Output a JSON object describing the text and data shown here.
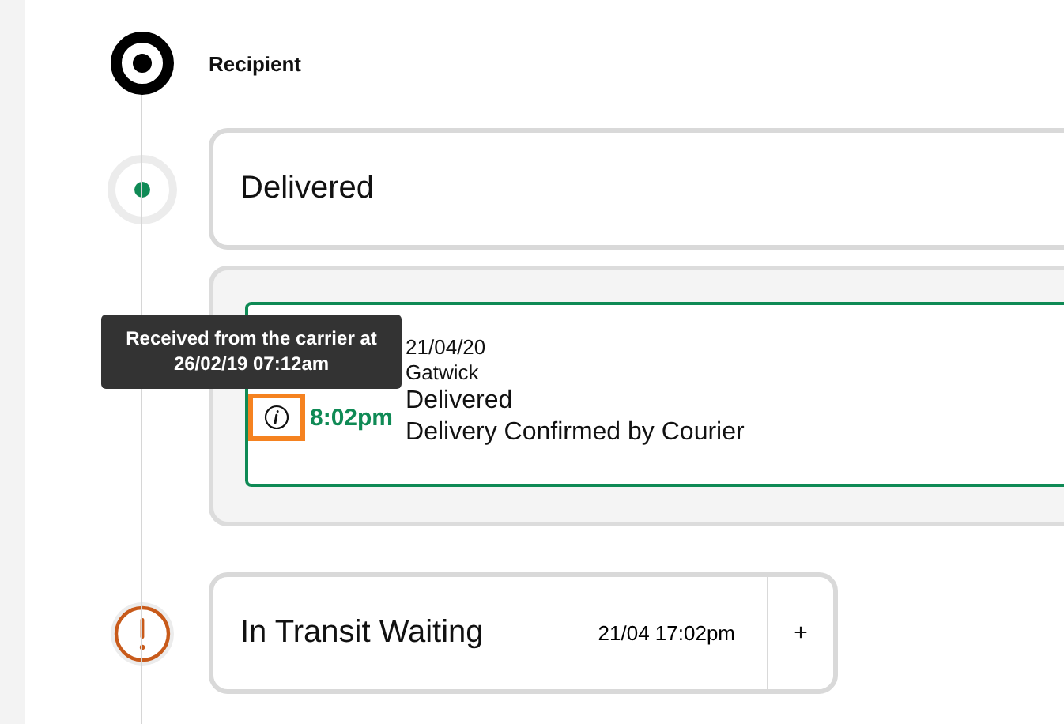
{
  "recipient": {
    "label": "Recipient"
  },
  "events": [
    {
      "kind": "delivered",
      "status": "Delivered",
      "expanded": true,
      "details": [
        {
          "time": "8:02pm",
          "date": "21/04/20",
          "location": "Gatwick",
          "status": "Delivered",
          "description": "Delivery Confirmed by Courier",
          "focused": true,
          "tooltip": "Received from the carrier at 26/02/19 07:12am"
        }
      ]
    },
    {
      "kind": "warning",
      "status": "In Transit Waiting",
      "expanded": false,
      "timestamp": "21/04 17:02pm",
      "expand_button": "+"
    }
  ]
}
